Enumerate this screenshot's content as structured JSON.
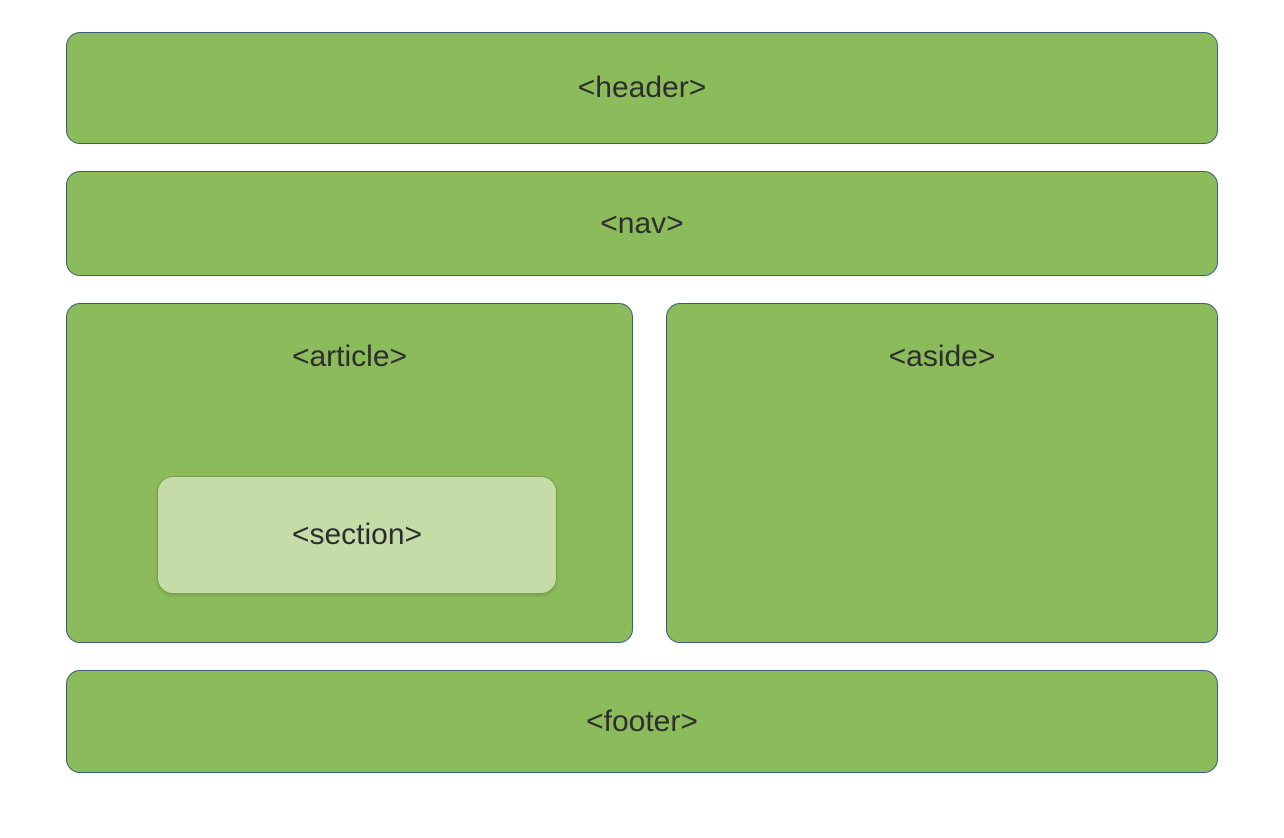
{
  "layout": {
    "header": "<header>",
    "nav": "<nav>",
    "article": "<article>",
    "section": "<section>",
    "aside": "<aside>",
    "footer": "<footer>"
  }
}
